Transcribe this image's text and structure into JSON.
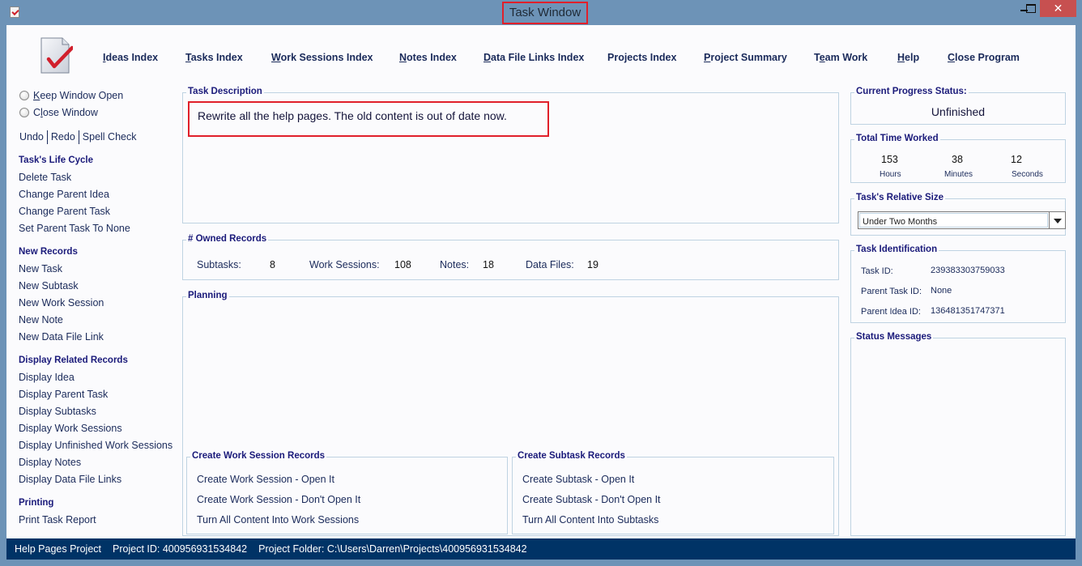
{
  "window": {
    "title": "Task Window",
    "close_glyph": "✕"
  },
  "topnav": [
    {
      "label": "Ideas Index",
      "mnemonic": "I",
      "rest": "deas Index"
    },
    {
      "label": "Tasks Index",
      "mnemonic": "T",
      "rest": "asks Index"
    },
    {
      "label": "Work Sessions Index",
      "mnemonic": "W",
      "rest": "ork Sessions Index"
    },
    {
      "label": "Notes Index",
      "mnemonic": "N",
      "rest": "otes Index"
    },
    {
      "label": "Data File Links Index",
      "mnemonic": "D",
      "rest": "ata File Links Index"
    },
    {
      "label": "Projects Index",
      "mnemonic": "",
      "rest": "Projects Index"
    },
    {
      "label": "Project Summary",
      "mnemonic": "P",
      "rest": "roject Summary"
    },
    {
      "label": "Team Work",
      "pre": "T",
      "mnemonic": "e",
      "rest": "am Work"
    },
    {
      "label": "Help",
      "mnemonic": "H",
      "rest": "elp"
    },
    {
      "label": "Close Program",
      "mnemonic": "C",
      "rest": "lose Program"
    }
  ],
  "sidebar": {
    "keep_open": {
      "pre": "",
      "mnemonic": "K",
      "rest": "eep Window Open"
    },
    "close_window": {
      "pre": "C",
      "mnemonic": "l",
      "rest": "ose Window"
    },
    "undo": "Undo",
    "redo": "Redo",
    "spell_check": "Spell Check",
    "sections": [
      {
        "heading": "Task's Life Cycle",
        "items": [
          "Delete Task",
          "Change Parent Idea",
          "Change Parent Task",
          "Set Parent Task To None"
        ]
      },
      {
        "heading": "New Records",
        "items": [
          "New Task",
          "New Subtask",
          "New Work Session",
          "New Note",
          "New Data File Link"
        ]
      },
      {
        "heading": "Display Related Records",
        "items": [
          "Display Idea",
          "Display Parent Task",
          "Display Subtasks",
          "Display Work Sessions",
          "Display Unfinished Work Sessions",
          "Display Notes",
          "Display Data File Links"
        ]
      },
      {
        "heading": "Printing",
        "items": [
          "Print Task Report"
        ]
      }
    ]
  },
  "task_description": {
    "title": "Task Description",
    "text": "Rewrite all the help pages. The old content is out of date now."
  },
  "owned_records": {
    "title": "# Owned Records",
    "subtasks_label": "Subtasks:",
    "subtasks_value": "8",
    "work_sessions_label": "Work Sessions:",
    "work_sessions_value": "108",
    "notes_label": "Notes:",
    "notes_value": "18",
    "data_files_label": "Data Files:",
    "data_files_value": "19"
  },
  "planning": {
    "title": "Planning",
    "work_sessions": {
      "title": "Create Work Session Records",
      "items": [
        "Create Work Session - Open It",
        "Create Work Session - Don't Open It",
        "Turn All Content Into Work Sessions"
      ]
    },
    "subtasks": {
      "title": "Create Subtask Records",
      "items": [
        "Create Subtask - Open It",
        "Create Subtask - Don't Open It",
        "Turn All Content Into Subtasks"
      ]
    }
  },
  "progress": {
    "title": "Current Progress Status:",
    "value": "Unfinished"
  },
  "time_worked": {
    "title": "Total Time Worked",
    "hours": "153",
    "hours_label": "Hours",
    "minutes": "38",
    "minutes_label": "Minutes",
    "seconds": "12",
    "seconds_label": "Seconds"
  },
  "relative_size": {
    "title": "Task's Relative Size",
    "selected": "Under Two Months"
  },
  "identification": {
    "title": "Task Identification",
    "task_id_label": "Task ID:",
    "task_id": "239383303759033",
    "parent_task_label": "Parent Task ID:",
    "parent_task": "None",
    "parent_idea_label": "Parent Idea ID:",
    "parent_idea": "136481351747371"
  },
  "status_messages": {
    "title": "Status Messages"
  },
  "statusbar": {
    "project_name": "Help Pages Project",
    "project_id": "Project ID:  400956931534842",
    "project_folder": "Project Folder: C:\\Users\\Darren\\Projects\\400956931534842"
  }
}
